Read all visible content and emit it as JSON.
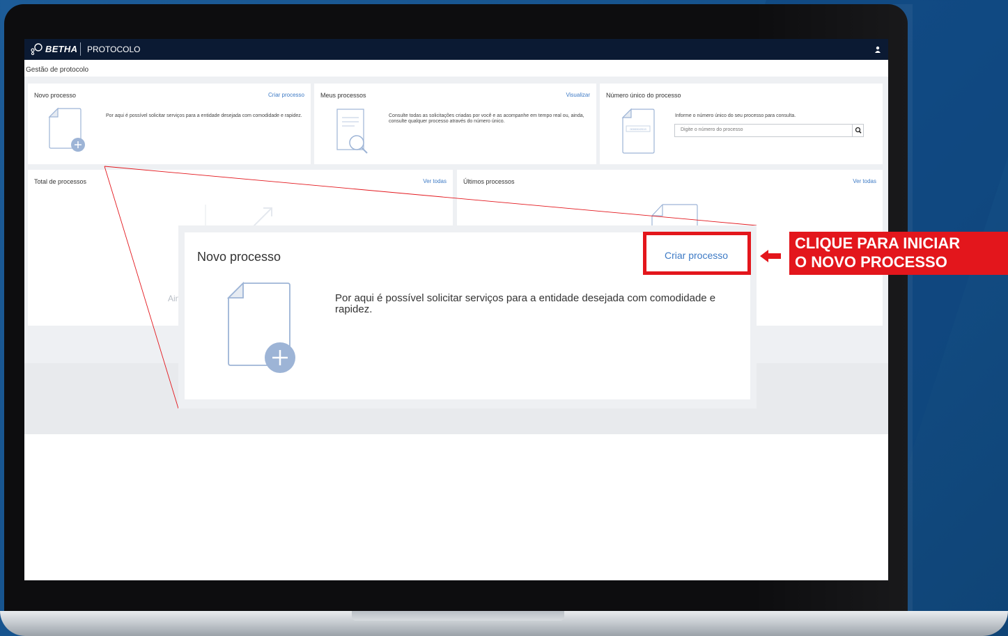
{
  "header": {
    "brand": "BETHA",
    "app_name": "PROTOCOLO"
  },
  "breadcrumb": {
    "title": "Gestão de protocolo"
  },
  "cards": {
    "novo": {
      "title": "Novo processo",
      "link": "Criar processo",
      "text": "Por aqui é possível solicitar serviços para a entidade desejada com comodidade e rapidez."
    },
    "meus": {
      "title": "Meus processos",
      "link": "Visualizar",
      "text": "Consulte todas as solicitações criadas por você e as acompanhe em tempo real ou, ainda, consulte qualquer processo através do número único."
    },
    "numero": {
      "title": "Número único do processo",
      "text": "Informe o número único do seu processo para consulta.",
      "placeholder": "Digite o número do processo",
      "doc_label": "000000/2019"
    },
    "total": {
      "title": "Total de processos",
      "link": "Ver todas",
      "faded_text": "Ain"
    },
    "ultimos": {
      "title": "Últimos processos",
      "link": "Ver todas"
    }
  },
  "zoom": {
    "title": "Novo processo",
    "link": "Criar processo",
    "text": "Por aqui é possível solicitar serviços para a entidade desejada com comodidade e rapidez."
  },
  "callout": {
    "line1": "CLIQUE PARA INICIAR",
    "line2": "O NOVO PROCESSO"
  },
  "colors": {
    "navbar": "#0b1a33",
    "link": "#3d7ac5",
    "highlight": "#e3161c",
    "background": "#1d5c98"
  }
}
